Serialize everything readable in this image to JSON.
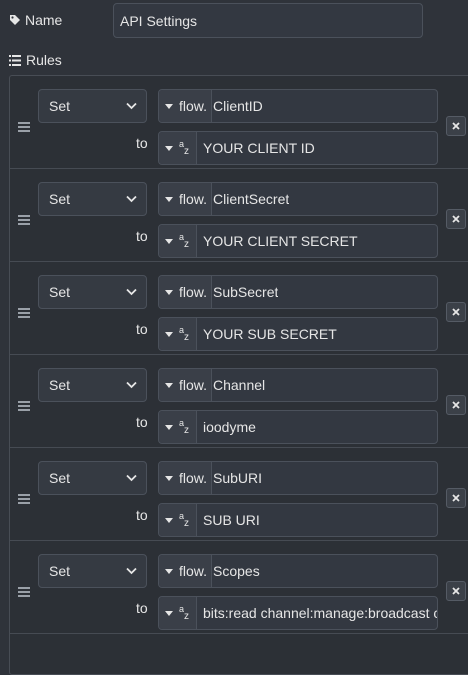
{
  "name_field": {
    "label": "Name",
    "value": "API Settings"
  },
  "rules_label": "Rules",
  "rules": [
    {
      "action": "Set",
      "target_type": "flow.",
      "target": "ClientID",
      "to_label": "to",
      "value": "YOUR CLIENT ID"
    },
    {
      "action": "Set",
      "target_type": "flow.",
      "target": "ClientSecret",
      "to_label": "to",
      "value": "YOUR CLIENT SECRET"
    },
    {
      "action": "Set",
      "target_type": "flow.",
      "target": "SubSecret",
      "to_label": "to",
      "value": "YOUR SUB SECRET"
    },
    {
      "action": "Set",
      "target_type": "flow.",
      "target": "Channel",
      "to_label": "to",
      "value": "ioodyme"
    },
    {
      "action": "Set",
      "target_type": "flow.",
      "target": "SubURI",
      "to_label": "to",
      "value": "SUB URI"
    },
    {
      "action": "Set",
      "target_type": "flow.",
      "target": "Scopes",
      "to_label": "to",
      "value": "bits:read channel:manage:broadcast channel:read:subscriptions"
    }
  ],
  "colors": {
    "background": "#2f333a",
    "input_bg": "#333841",
    "border": "#4b515b",
    "text": "#e6e6e6"
  },
  "icons": {
    "name": "tag-icon",
    "rules": "list-icon",
    "grip": "drag-handle-icon",
    "delete": "close-icon",
    "chevron": "chevron-down-icon",
    "string": "az-string-icon"
  }
}
